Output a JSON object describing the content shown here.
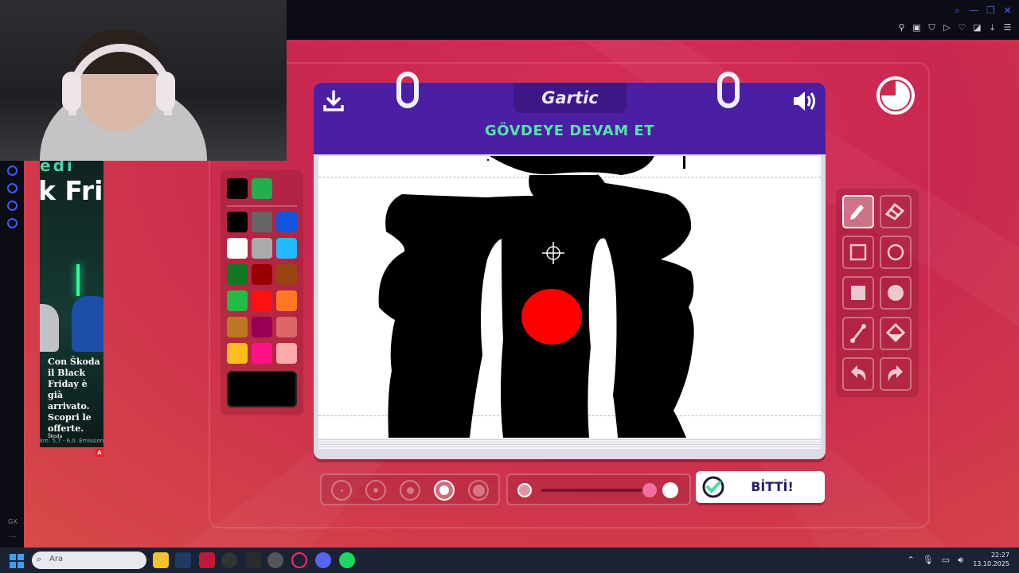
{
  "game": {
    "logo": "Gartic",
    "instruction": "GÖVDEYE DEVAM ET",
    "done_label": "BİTTİ!",
    "palette": {
      "selected": [
        "#000000",
        "#22b04b"
      ],
      "colors": [
        "#000000",
        "#666666",
        "#1155dd",
        "#ffffff",
        "#aaaaaa",
        "#22bbff",
        "#117722",
        "#990000",
        "#994411",
        "#22bb44",
        "#ff1111",
        "#ff7722",
        "#bb7722",
        "#990055",
        "#dd6666",
        "#ffbb22",
        "#ff1188",
        "#ffaaaa"
      ],
      "current": "#000000"
    },
    "tools": [
      {
        "name": "pencil",
        "active": true
      },
      {
        "name": "eraser",
        "active": false
      },
      {
        "name": "rectangle-outline",
        "active": false
      },
      {
        "name": "circle-outline",
        "active": false
      },
      {
        "name": "rectangle-filled",
        "active": false
      },
      {
        "name": "circle-filled",
        "active": false
      },
      {
        "name": "line",
        "active": false
      },
      {
        "name": "fill-bucket",
        "active": false
      },
      {
        "name": "undo",
        "active": false
      },
      {
        "name": "redo",
        "active": false
      }
    ],
    "brush_sizes": {
      "count": 5,
      "selected_index": 3
    },
    "opacity": 0.9,
    "timer_remaining": 0.75
  },
  "ad": {
    "top_text": "edi",
    "headline": "k Fri",
    "body": "Con Škoda il Black Friday è già arrivato. Scopri le offerte.",
    "brand": "Škoda",
    "small_print": "km: 5,7 - 6,0. Emission"
  },
  "taskbar": {
    "search_placeholder": "Ara",
    "time": "22:27",
    "date": "13.10.2025"
  },
  "sidebar": {
    "gx_label": "GX",
    "more_label": "..."
  }
}
